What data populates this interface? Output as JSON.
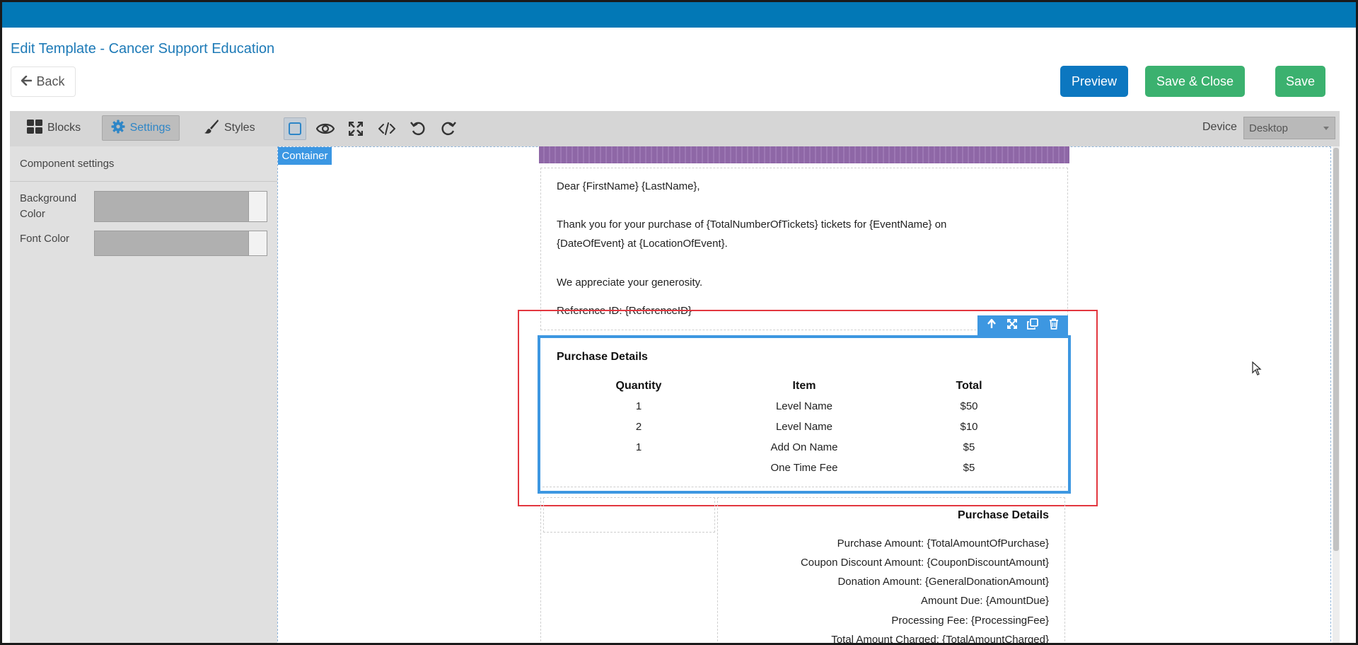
{
  "header": {
    "title": "Edit Template - Cancer Support Education",
    "back_label": "Back",
    "preview_label": "Preview",
    "save_close_label": "Save & Close",
    "save_label": "Save"
  },
  "colors": {
    "topbar": "#0278b6",
    "primary": "#0c77c0",
    "success": "#3bb16f",
    "selection_blue": "#3d97e1",
    "highlight_red": "#e2373f",
    "banner_purple": "#8e67a6"
  },
  "panel_tabs": {
    "blocks": "Blocks",
    "settings": "Settings",
    "styles": "Styles",
    "active": "settings"
  },
  "sidebar": {
    "section_title": "Component settings",
    "fields": [
      {
        "label_line1": "Background",
        "label_line2": "Color"
      },
      {
        "label_line1": "Font Color"
      }
    ]
  },
  "canvas_toolbar": {
    "icons": [
      "border-toggle-icon",
      "preview-eye-icon",
      "fullscreen-icon",
      "code-icon",
      "undo-icon",
      "redo-icon"
    ],
    "device_label": "Device",
    "device_value": "Desktop"
  },
  "canvas": {
    "container_badge": "Container"
  },
  "email": {
    "greeting": "Dear {FirstName} {LastName},",
    "thanks_line1": "Thank you for your purchase of {TotalNumberOfTickets} tickets for {EventName} on",
    "thanks_line2": "{DateOfEvent} at {LocationOfEvent}.",
    "appreciate": "We appreciate your generosity.",
    "reference": "Reference ID: {ReferenceID}"
  },
  "purchase_table": {
    "title": "Purchase Details",
    "headers": [
      "Quantity",
      "Item",
      "Total"
    ],
    "rows": [
      [
        "1",
        "Level Name",
        "$50"
      ],
      [
        "2",
        "Level Name",
        "$10"
      ],
      [
        "1",
        "Add On Name",
        "$5"
      ],
      [
        "",
        "One Time Fee",
        "$5"
      ]
    ]
  },
  "summary": {
    "title": "Purchase Details",
    "lines": [
      "Purchase Amount: {TotalAmountOfPurchase}",
      "Coupon Discount Amount: {CouponDiscountAmount}",
      "Donation Amount: {GeneralDonationAmount}",
      "Amount Due: {AmountDue}",
      "Processing Fee: {ProcessingFee}",
      "Total Amount Charged: {TotalAmountCharged}"
    ]
  }
}
